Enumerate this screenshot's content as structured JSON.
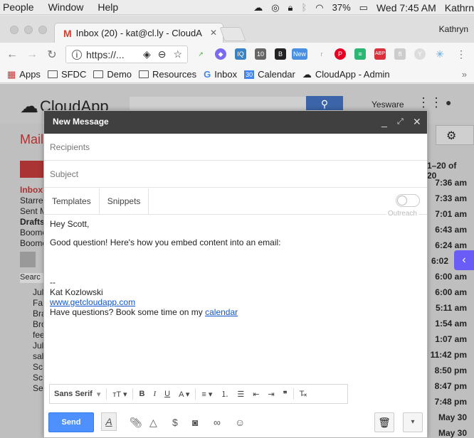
{
  "menubar": {
    "items": [
      "People",
      "Window",
      "Help"
    ],
    "battery": "37%",
    "clock": "Wed 7:45 AM",
    "user": "Kathrn"
  },
  "browser": {
    "tab_title": "Inbox (20) - kat@cl.ly - CloudA",
    "profile": "Kathryn",
    "url": "https://...",
    "bookmarks": [
      "Apps",
      "SFDC",
      "Demo",
      "Resources",
      "Inbox",
      "Calendar",
      "CloudApp - Admin"
    ],
    "ext_badges": [
      "IQ",
      "10",
      "New",
      "ABP"
    ]
  },
  "gmail": {
    "logo": "CloudApp",
    "yesware": "Yesware",
    "mail_label": "Mail",
    "left_items": [
      "Inbox",
      "Starre",
      "Sent M",
      "Drafts",
      "Boome",
      "Boome"
    ],
    "left_items2": [
      "Jul",
      "Fa",
      "Bra",
      "Bro",
      "fee",
      "Jul",
      "sal",
      "Sc",
      "Sc",
      "Se"
    ],
    "search_label": "Searc",
    "pager": "1–20 of 20",
    "times": [
      "7:36 am",
      "7:33 am",
      "7:01 am",
      "6:43 am",
      "6:24 am",
      "6:02",
      "6:00 am",
      "6:00 am",
      "5:11 am",
      "1:54 am",
      "1:07 am",
      "11:42 pm",
      "8:50 pm",
      "8:47 pm",
      "7:48 pm",
      "May 30",
      "May 30"
    ]
  },
  "compose": {
    "title": "New Message",
    "recipients_placeholder": "Recipients",
    "subject_placeholder": "Subject",
    "tabs": [
      "Templates",
      "Snippets"
    ],
    "outreach": "Outreach",
    "body": {
      "greeting": "Hey Scott,",
      "line1": "Good question! Here's how you embed content into an email:",
      "dashes": "--",
      "name": "Kat Kozlowski",
      "website": "www.getcloudapp.com",
      "cta": "Have questions? Book some time on my ",
      "cta_link": "calendar"
    },
    "font": "Sans Serif",
    "send_label": "Send"
  }
}
